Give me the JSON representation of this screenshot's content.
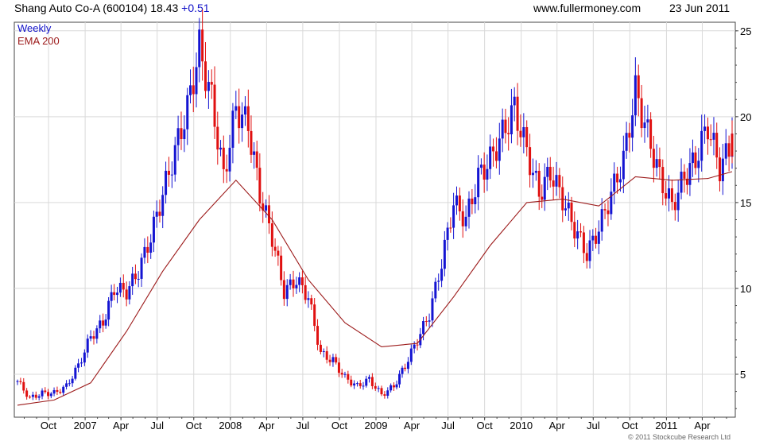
{
  "header": {
    "title": "Shang Auto Co-A (600104)",
    "price": "18.43",
    "change": "+0.51",
    "source": "www.fullermoney.com",
    "date": "23 Jun 2011"
  },
  "footer": {
    "copyright": "© 2011 Stockcube Research Ltd"
  },
  "colors": {
    "up": "#1414d2",
    "down": "#e01010",
    "ema": "#9c1a1a",
    "grid": "#d9d9d9",
    "weekly_label": "#1010c8"
  },
  "chart_data": {
    "type": "line",
    "title": "Shang Auto Co-A (600104)",
    "ylim": [
      2.5,
      25.5
    ],
    "y_ticks": [
      5,
      10,
      15,
      20,
      25
    ],
    "grid": true,
    "legend": [
      {
        "label": "Weekly",
        "color": "#1010c8"
      },
      {
        "label": "EMA 200",
        "color": "#9c1a1a"
      }
    ],
    "x_ticks": [
      "Oct",
      "2007",
      "Apr",
      "Jul",
      "Oct",
      "2008",
      "Apr",
      "Jul",
      "Oct",
      "2009",
      "Apr",
      "Jul",
      "Oct",
      "2010",
      "Apr",
      "Jul",
      "Oct",
      "2011",
      "Apr"
    ],
    "x_range": [
      "2006-07-07",
      "2011-06-23"
    ],
    "series": [
      {
        "name": "Weekly",
        "type": "close",
        "x": [
          "2006-07",
          "2006-08",
          "2006-09",
          "2006-10",
          "2006-11",
          "2006-12",
          "2007-01",
          "2007-02",
          "2007-03",
          "2007-04",
          "2007-05",
          "2007-06",
          "2007-07",
          "2007-08",
          "2007-09",
          "2007-10",
          "2007-11",
          "2007-12",
          "2008-01",
          "2008-02",
          "2008-03",
          "2008-04",
          "2008-05",
          "2008-06",
          "2008-07",
          "2008-08",
          "2008-09",
          "2008-10",
          "2008-11",
          "2008-12",
          "2009-01",
          "2009-02",
          "2009-03",
          "2009-04",
          "2009-05",
          "2009-06",
          "2009-07",
          "2009-08",
          "2009-09",
          "2009-10",
          "2009-11",
          "2009-12",
          "2010-01",
          "2010-02",
          "2010-03",
          "2010-04",
          "2010-05",
          "2010-06",
          "2010-07",
          "2010-08",
          "2010-09",
          "2010-10",
          "2010-11",
          "2010-12",
          "2011-01",
          "2011-02",
          "2011-03",
          "2011-04",
          "2011-05",
          "2011-06"
        ],
        "values": [
          4.6,
          3.6,
          3.9,
          3.9,
          4.3,
          5.5,
          7.2,
          8.0,
          10.0,
          9.8,
          11.0,
          13.0,
          15.5,
          18.0,
          20.5,
          24.0,
          21.0,
          16.5,
          20.5,
          19.5,
          15.5,
          13.0,
          9.8,
          10.5,
          9.5,
          6.2,
          5.8,
          4.8,
          4.3,
          4.7,
          3.8,
          4.3,
          5.5,
          7.0,
          8.5,
          11.5,
          15.0,
          14.0,
          16.5,
          17.5,
          19.0,
          20.5,
          18.0,
          15.5,
          16.8,
          15.2,
          13.5,
          12.0,
          13.5,
          15.5,
          17.5,
          21.5,
          19.0,
          16.5,
          14.8,
          16.5,
          17.5,
          19.5,
          17.0,
          18.43
        ]
      },
      {
        "name": "EMA 200",
        "x": [
          "2006-07",
          "2006-10",
          "2007-01",
          "2007-04",
          "2007-07",
          "2007-10",
          "2008-01",
          "2008-04",
          "2008-07",
          "2008-10",
          "2009-01",
          "2009-04",
          "2009-07",
          "2009-10",
          "2010-01",
          "2010-04",
          "2010-07",
          "2010-10",
          "2011-01",
          "2011-04",
          "2011-06"
        ],
        "values": [
          3.2,
          3.5,
          4.5,
          7.5,
          11.0,
          14.0,
          16.3,
          14.0,
          10.5,
          8.0,
          6.6,
          6.8,
          9.5,
          12.5,
          15.0,
          15.2,
          14.8,
          16.5,
          16.3,
          16.4,
          16.8
        ]
      }
    ]
  }
}
